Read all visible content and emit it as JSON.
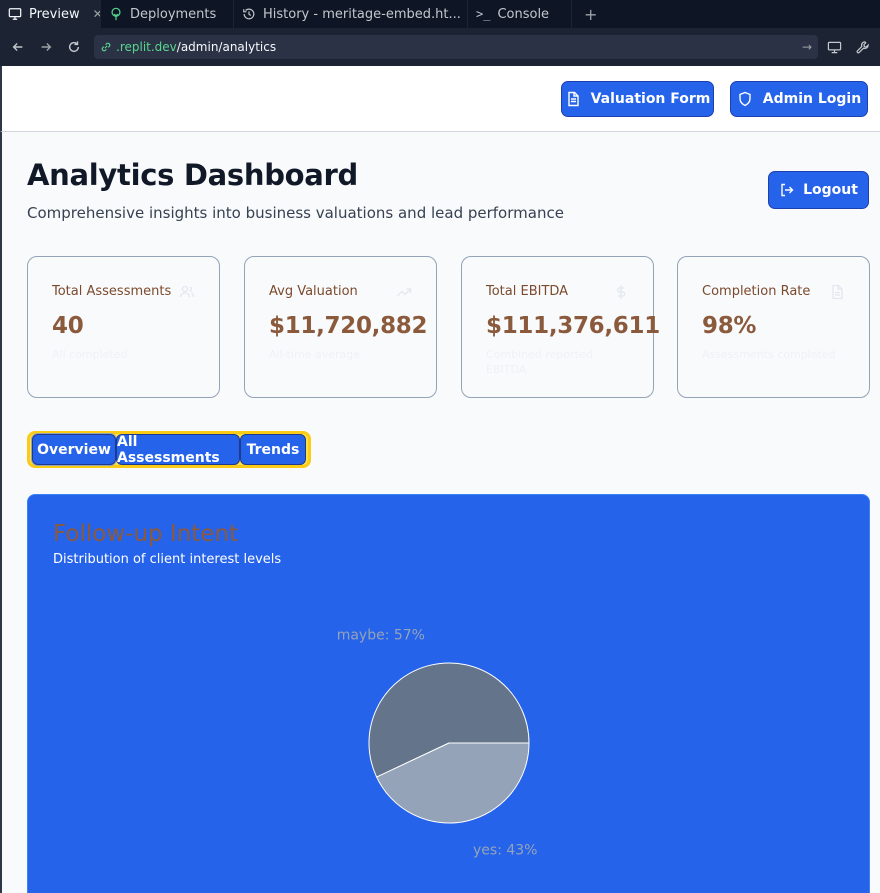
{
  "browser": {
    "tabs": [
      {
        "label": "Preview",
        "icon": "monitor-icon",
        "active": true
      },
      {
        "label": "Deployments",
        "icon": "deploy-icon",
        "active": false
      },
      {
        "label": "History - meritage-embed.ht...",
        "icon": "history-icon",
        "active": false
      },
      {
        "label": "Console",
        "icon": "terminal-icon",
        "active": false
      }
    ],
    "url_host": ".replit.dev",
    "url_path": "/admin/analytics"
  },
  "header": {
    "valuation_label": "Valuation Form",
    "admin_label": "Admin Login"
  },
  "page": {
    "title": "Analytics Dashboard",
    "subtitle": "Comprehensive insights into business valuations and lead performance",
    "logout_label": "Logout"
  },
  "stats": [
    {
      "label": "Total Assessments",
      "value": "40",
      "note": "All completed",
      "icon": "users-icon"
    },
    {
      "label": "Avg Valuation",
      "value": "$11,720,882",
      "note": "All-time average",
      "icon": "trending-up-icon"
    },
    {
      "label": "Total EBITDA",
      "value": "$111,376,611",
      "note": "Combined reported EBITDA",
      "icon": "dollar-icon"
    },
    {
      "label": "Completion Rate",
      "value": "98%",
      "note": "Assessments completed",
      "icon": "document-icon"
    }
  ],
  "tabs": {
    "overview": "Overview",
    "all": "All Assessments",
    "trends": "Trends"
  },
  "chart_panel": {
    "title": "Follow-up Intent",
    "subtitle": "Distribution of client interest levels"
  },
  "chart_data": {
    "type": "pie",
    "title": "Follow-up Intent",
    "slices": [
      {
        "name": "maybe",
        "value": 57,
        "label": "maybe: 57%",
        "color": "#64748b"
      },
      {
        "name": "yes",
        "value": 43,
        "label": "yes: 43%",
        "color": "#94a3b8"
      }
    ],
    "label_color": "#94a3b8",
    "stroke": "#ffffff"
  },
  "colors": {
    "primary": "#2563eb",
    "highlight": "#facc15",
    "value_text": "#8b5a3c"
  }
}
